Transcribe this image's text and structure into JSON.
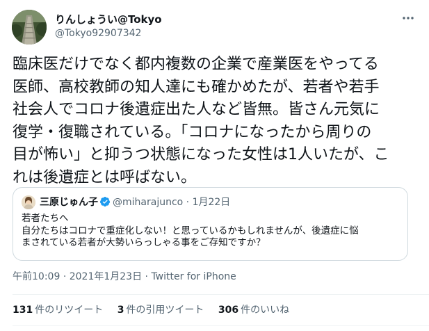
{
  "author": {
    "display_name": "りんしょうい@Tokyo",
    "handle": "@Tokyo92907342"
  },
  "more_icon": "more-horizontal-icon",
  "tweet_lines": [
    "臨床医だけでなく都内複数の企業で産業医をやってる",
    "医師、高校教師の知人達にも確かめたが、若者や若手",
    "社会人でコロナ後遺症出た人など皆無。皆さん元気に",
    "復学・復職されている。「コロナになったから周りの",
    "目が怖い」と抑うつ状態になった女性は1人いたが、こ",
    "れは後遺症とは呼ばない。"
  ],
  "quote": {
    "display_name": "三原じゅん子",
    "verified_icon": "verified-badge-icon",
    "handle": "@miharajunco",
    "separator": "·",
    "date": "1月22日",
    "lines": [
      "若者たちへ",
      "自分たちはコロナで重症化しない！と思っているかもしれませんが、後遺症に悩",
      "まされている若者が大勢いらっしゃる事をご存知ですか？"
    ]
  },
  "meta": {
    "time": "午前10:09",
    "date": "2021年1月23日",
    "source": "Twitter for iPhone",
    "separator": "·"
  },
  "stats": {
    "retweets_count": "131",
    "retweets_label": "件のリツイート",
    "quotes_count": "3",
    "quotes_label": "件の引用ツイート",
    "likes_count": "306",
    "likes_label": "件のいいね"
  },
  "colors": {
    "text": "#0f1419",
    "secondary": "#536471",
    "border": "#cfd9de",
    "verified": "#1d9bf0"
  }
}
